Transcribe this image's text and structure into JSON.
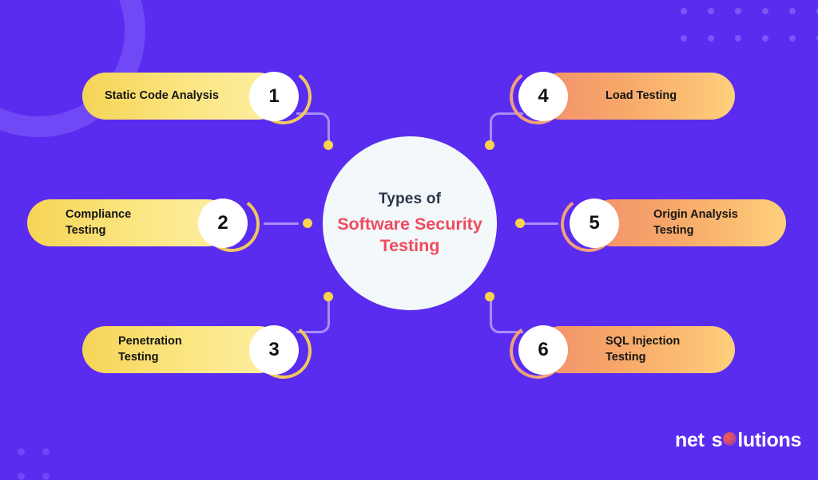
{
  "background_color": "#5a2cf0",
  "center": {
    "line1": "Types of",
    "line2": "Software Security Testing",
    "line1_color": "#2d3547",
    "line2_color": "#f04a5e",
    "circle_color": "#f3f8fb"
  },
  "items_left": [
    {
      "number": "1",
      "label": "Static Code Analysis"
    },
    {
      "number": "2",
      "label": "Compliance Testing"
    },
    {
      "number": "3",
      "label": "Penetration Testing"
    }
  ],
  "items_right": [
    {
      "number": "4",
      "label": "Load Testing"
    },
    {
      "number": "5",
      "label": "Origin Analysis\nTesting"
    },
    {
      "number": "6",
      "label": "SQL Injection\nTesting"
    }
  ],
  "logo": {
    "word1": "net",
    "word2_part1": "s",
    "word2_part2": "lutions",
    "icon": "gradient-circle-o"
  },
  "colors": {
    "card_left_gradient_start": "#f5d456",
    "card_left_gradient_end": "#fdefa3",
    "card_right_gradient_start": "#f2906d",
    "card_right_gradient_end": "#fcd07c",
    "connector": "#a98df8",
    "connector_dot": "#f9d24e",
    "badge_bg": "#ffffff",
    "arc_left": "#f0c85e",
    "arc_right": "#f2a07a",
    "decor_ring": "#6f49f5",
    "decor_dot": "#7a57f7"
  }
}
